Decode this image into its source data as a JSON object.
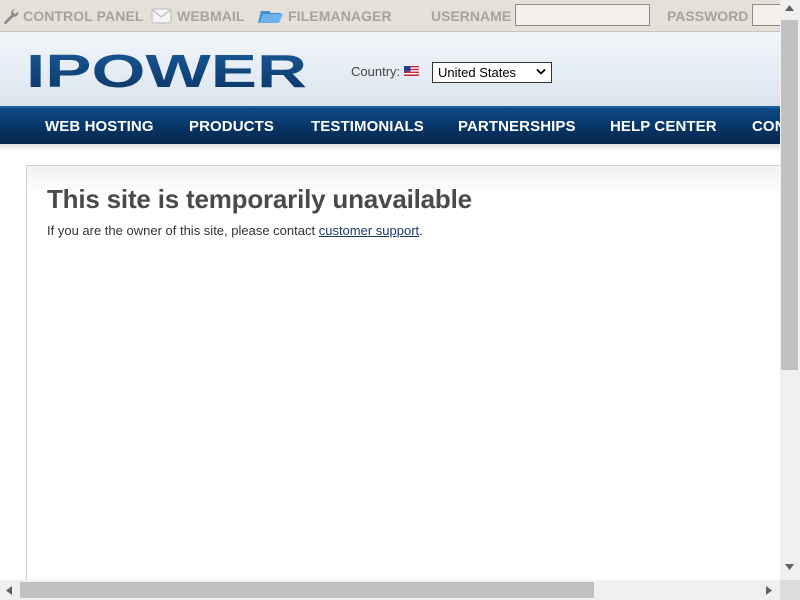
{
  "topbar": {
    "control_panel": "CONTROL PANEL",
    "webmail": "WEBMAIL",
    "filemanager": "FILEMANAGER",
    "username_label": "USERNAME",
    "username_value": "",
    "password_label": "PASSWORD",
    "password_value": ""
  },
  "header": {
    "logo_text": "IPOWER",
    "country_label": "Country:",
    "country_selected": "United States",
    "brand_color": "#0d3f73"
  },
  "nav": {
    "items": [
      "WEB HOSTING",
      "PRODUCTS",
      "TESTIMONIALS",
      "PARTNERSHIPS",
      "HELP CENTER",
      "CON"
    ]
  },
  "main": {
    "title": "This site is temporarily unavailable",
    "message_prefix": "If you are the owner of this site, please contact ",
    "support_link": "customer support",
    "message_suffix": "."
  }
}
